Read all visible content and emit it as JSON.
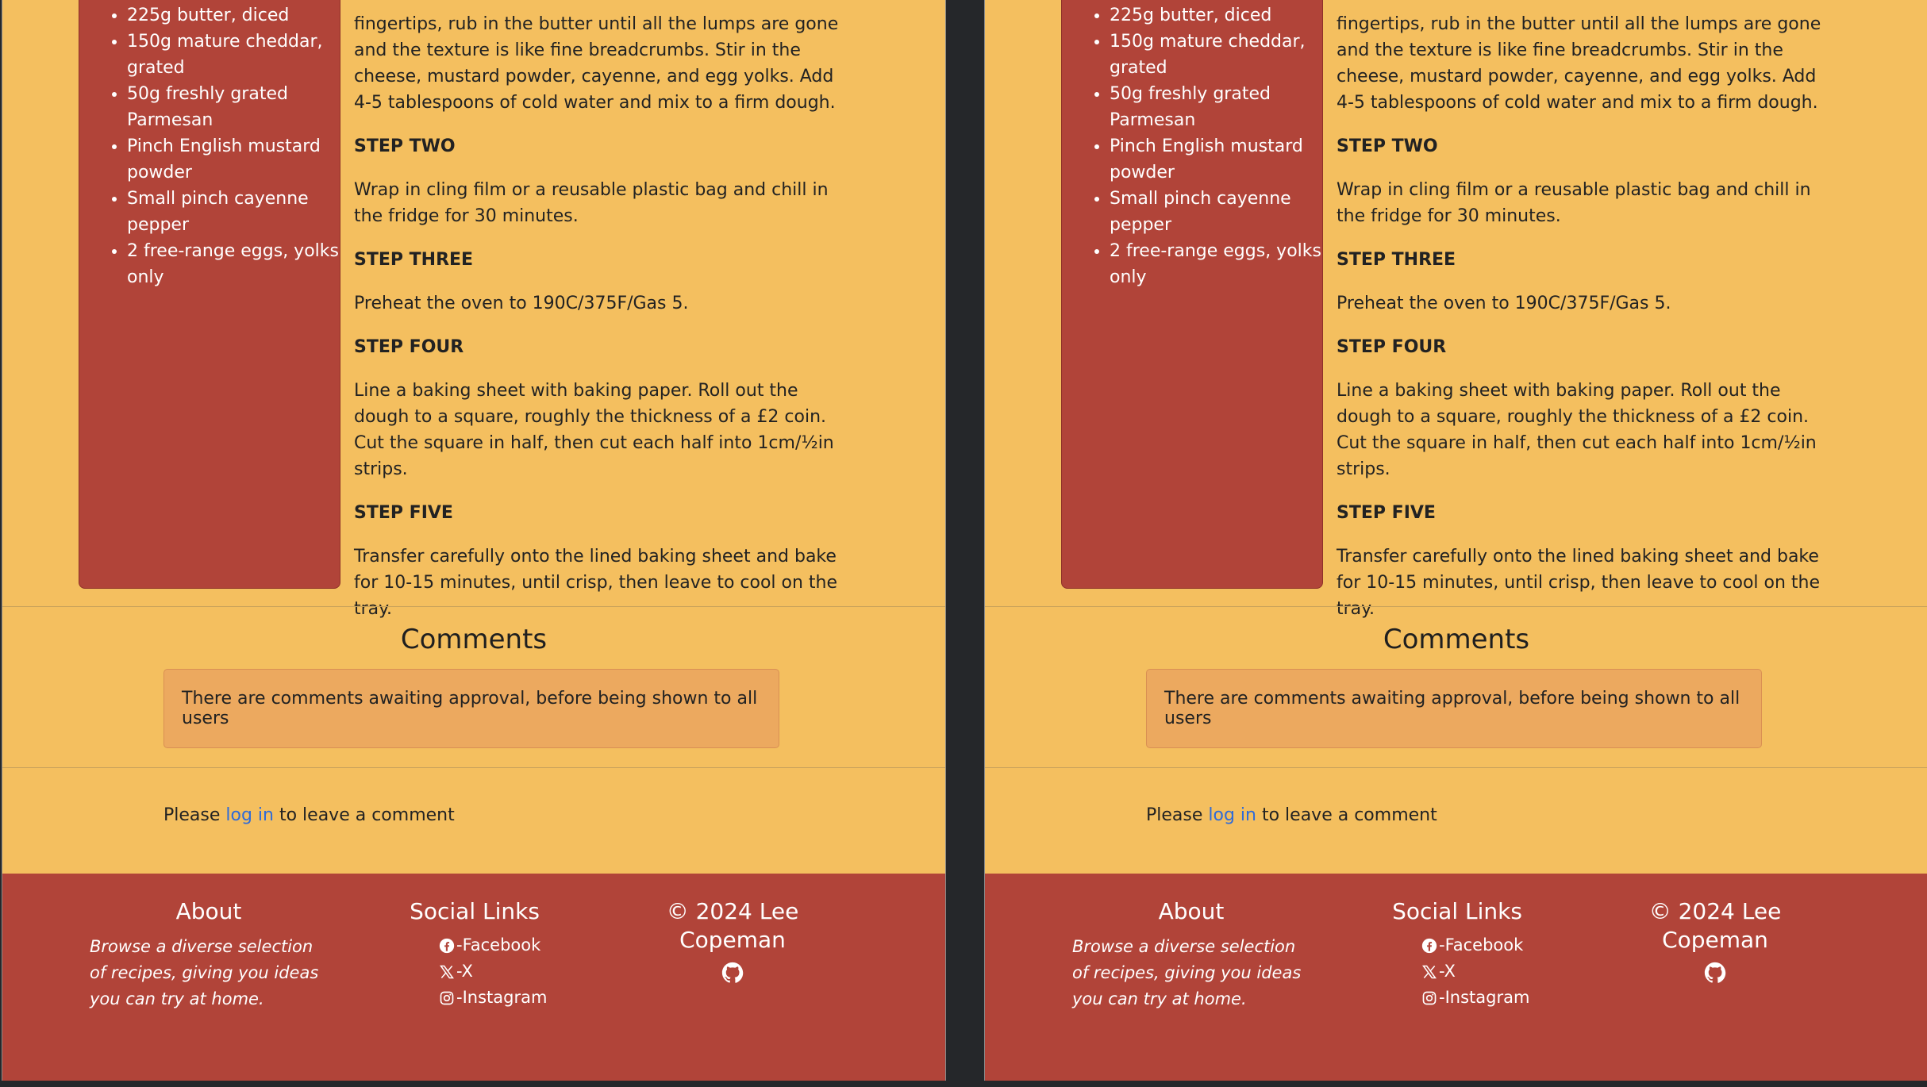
{
  "ingredients": [
    "225g butter, diced",
    "150g mature cheddar, grated",
    "50g freshly grated Parmesan",
    "Pinch English mustard powder",
    "Small pinch cayenne pepper",
    "2 free-range eggs, yolks only"
  ],
  "method": {
    "continuation": "fingertips, rub in the butter until all the lumps are gone and the texture is like fine breadcrumbs. Stir in the cheese, mustard powder, cayenne, and egg yolks. Add 4-5 tablespoons of cold water and mix to a firm dough.",
    "steps": [
      {
        "heading": "STEP TWO",
        "text": "Wrap in cling film or a reusable plastic bag and chill in the fridge for 30 minutes."
      },
      {
        "heading": "STEP THREE",
        "text": "Preheat the oven to 190C/375F/Gas 5."
      },
      {
        "heading": "STEP FOUR",
        "text": "Line a baking sheet with baking paper. Roll out the dough to a square, roughly the thickness of a £2 coin. Cut the square in half, then cut each half into 1cm/½in strips."
      },
      {
        "heading": "STEP FIVE",
        "text": "Transfer carefully onto the lined baking sheet and bake for 10-15 minutes, until crisp, then leave to cool on the tray."
      }
    ]
  },
  "comments": {
    "title": "Comments",
    "notice": "There are comments awaiting approval, before being shown to all users",
    "login_prefix": "Please ",
    "login_link": "log in",
    "login_suffix": " to leave a comment"
  },
  "footer": {
    "about_title": "About",
    "about_text": "Browse a diverse selection of recipes, giving you ideas you can try at home.",
    "social_title": "Social Links",
    "social_links": [
      {
        "label": "-Facebook",
        "icon": "facebook-icon"
      },
      {
        "label": "-X",
        "icon": "x-icon"
      },
      {
        "label": "-Instagram",
        "icon": "instagram-icon"
      }
    ],
    "copyright": "© 2024 Lee Copeman",
    "github_icon": "github-icon"
  },
  "colors": {
    "page_bg": "#f4bf5f",
    "accent_red": "#b14439",
    "notice_bg": "#eca95f",
    "link": "#2f6bd8",
    "gutter": "#25272a"
  }
}
